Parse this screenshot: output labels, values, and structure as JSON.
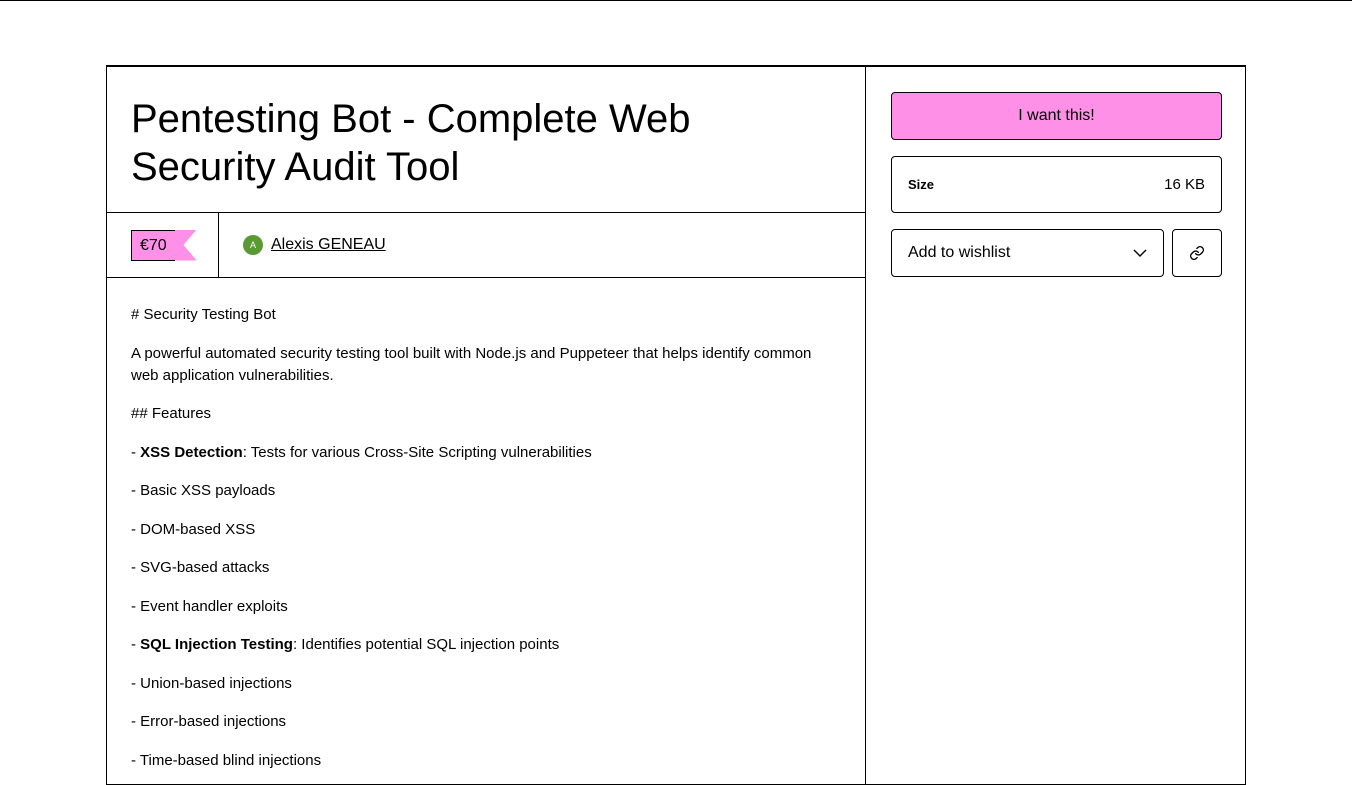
{
  "product": {
    "title": "Pentesting Bot - Complete Web Security Audit Tool",
    "price": "€70",
    "author": "Alexis GENEAU",
    "author_initial": "A"
  },
  "description": [
    {
      "text": "# Security Testing Bot"
    },
    {
      "text": "A powerful automated security testing tool built with Node.js and Puppeteer that helps identify common web application vulnerabilities."
    },
    {
      "text": "## Features"
    },
    {
      "bold": "XSS Detection",
      "text": ": Tests for various Cross-Site Scripting vulnerabilities"
    },
    {
      "text": "- Basic XSS payloads"
    },
    {
      "text": "- DOM-based XSS"
    },
    {
      "text": "- SVG-based attacks"
    },
    {
      "text": "- Event handler exploits"
    },
    {
      "bold": "SQL Injection Testing",
      "text": ": Identifies potential SQL injection points"
    },
    {
      "text": "- Union-based injections"
    },
    {
      "text": "- Error-based injections"
    },
    {
      "text": "- Time-based blind injections"
    }
  ],
  "sidebar": {
    "buy_label": "I want this!",
    "size_label": "Size",
    "size_value": "16 KB",
    "wishlist_label": "Add to wishlist"
  }
}
